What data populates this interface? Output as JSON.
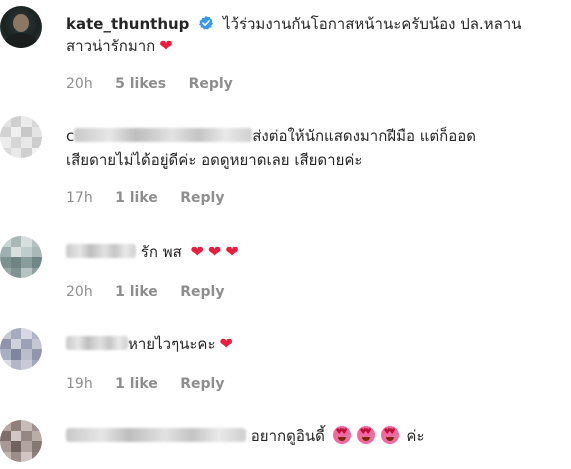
{
  "comments": [
    {
      "username": "kate_thunthup",
      "verified": true,
      "text_line1": "ไว้ร่วมงานกันโอกาสหน้านะครับน้อง ปล.หลาน",
      "text_line2": "สาวน่ารักมาก",
      "emoji": "red-heart",
      "time": "20h",
      "likes": "5 likes",
      "reply": "Reply"
    },
    {
      "username_initial": "c",
      "text_line1": "ส่งต่อให้นักแสดงมากฝีมือ แต่ก็ออด",
      "text_line2": "เสียดายไม่ได้อยู่ดีค่ะ อดดูหยาดเลย เสียดายค่ะ",
      "time": "17h",
      "likes": "1 like",
      "reply": "Reply"
    },
    {
      "text": "รัก พส",
      "emoji": "red-heart x3",
      "time": "20h",
      "likes": "1 like",
      "reply": "Reply"
    },
    {
      "text": "หายไวๆนะคะ",
      "emoji": "red-heart",
      "time": "19h",
      "likes": "1 like",
      "reply": "Reply"
    },
    {
      "text_before": "อยากดูอินดี้",
      "emoji": "smiling-face-with-heart-eyes x3",
      "text_after": "ค่ะ"
    }
  ],
  "icons": {
    "verified_color": "#3897f0",
    "heart_color": "#ed1c3c"
  }
}
